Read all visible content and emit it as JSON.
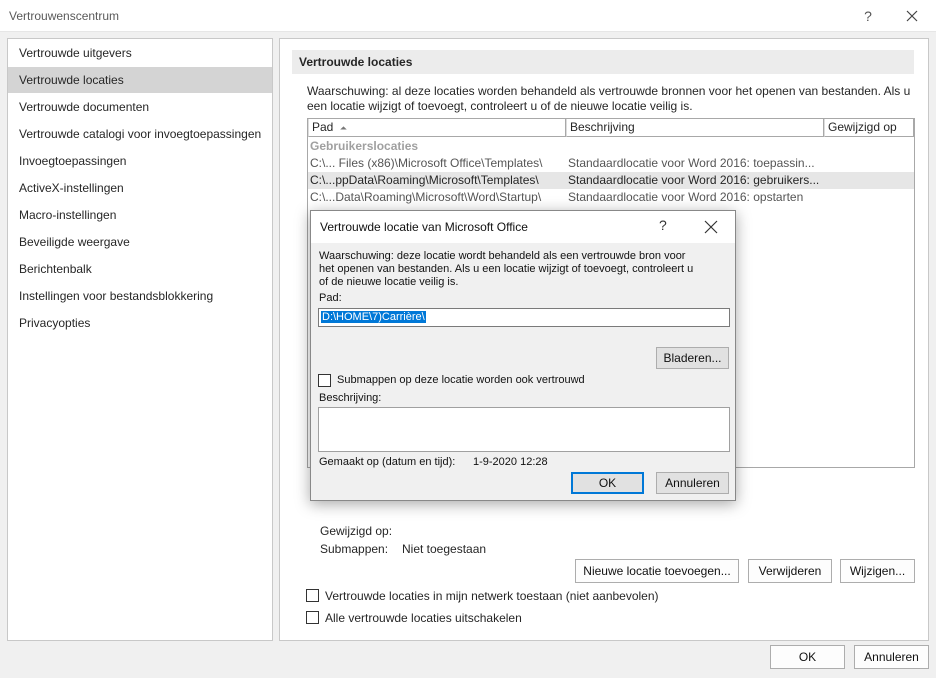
{
  "window": {
    "title": "Vertrouwenscentrum",
    "help": "?",
    "ok": "OK",
    "cancel": "Annuleren"
  },
  "nav": {
    "items": [
      "Vertrouwde uitgevers",
      "Vertrouwde locaties",
      "Vertrouwde documenten",
      "Vertrouwde catalogi voor invoegtoepassingen",
      "Invoegtoepassingen",
      "ActiveX-instellingen",
      "Macro-instellingen",
      "Beveiligde weergave",
      "Berichtenbalk",
      "Instellingen voor bestandsblokkering",
      "Privacyopties"
    ],
    "selected_index": 1
  },
  "panel": {
    "header": "Vertrouwde locaties",
    "warning_line1": "Waarschuwing: al deze locaties worden behandeld als vertrouwde bronnen voor het openen van bestanden. Als u",
    "warning_line2": "een locatie wijzigt of toevoegt, controleert u of de nieuwe locatie veilig is.",
    "columns": [
      "Pad",
      "Beschrijving",
      "Gewijzigd op"
    ],
    "sort_indicator": "⏶",
    "group": "Gebruikerslocaties",
    "rows": [
      {
        "path": "C:\\... Files (x86)\\Microsoft Office\\Templates\\",
        "desc": "Standaardlocatie voor Word 2016: toepassin..."
      },
      {
        "path": "C:\\...ppData\\Roaming\\Microsoft\\Templates\\",
        "desc": "Standaardlocatie voor Word 2016: gebruikers..."
      },
      {
        "path": "C:\\...Data\\Roaming\\Microsoft\\Word\\Startup\\",
        "desc": "Standaardlocatie voor Word 2016: opstarten"
      }
    ],
    "selected_row": 1,
    "modified_label": "Gewijzigd op:",
    "subfolders_label": "Submappen:",
    "subfolders_value": "Niet toegestaan",
    "btn_add": "Nieuwe locatie toevoegen...",
    "btn_remove": "Verwijderen",
    "btn_modify": "Wijzigen...",
    "chk_network": "Vertrouwde locaties in mijn netwerk toestaan (niet aanbevolen)",
    "chk_disable": "Alle vertrouwde locaties uitschakelen"
  },
  "dialog": {
    "title": "Vertrouwde locatie van Microsoft Office",
    "help": "?",
    "warning_line1": "Waarschuwing: deze locatie wordt behandeld als een vertrouwde bron voor",
    "warning_line2": "het openen van bestanden. Als u een locatie wijzigt of toevoegt, controleert u",
    "warning_line3": "of de nieuwe locatie veilig is.",
    "path_label": "Pad:",
    "path_value": "D:\\HOME\\7)Carrière\\",
    "browse": "Bladeren...",
    "subfolders_chk": "Submappen op deze locatie worden ook vertrouwd",
    "desc_label": "Beschrijving:",
    "created_label": "Gemaakt op (datum en tijd):",
    "created_value": "1-9-2020 12:28",
    "ok": "OK",
    "cancel": "Annuleren"
  }
}
